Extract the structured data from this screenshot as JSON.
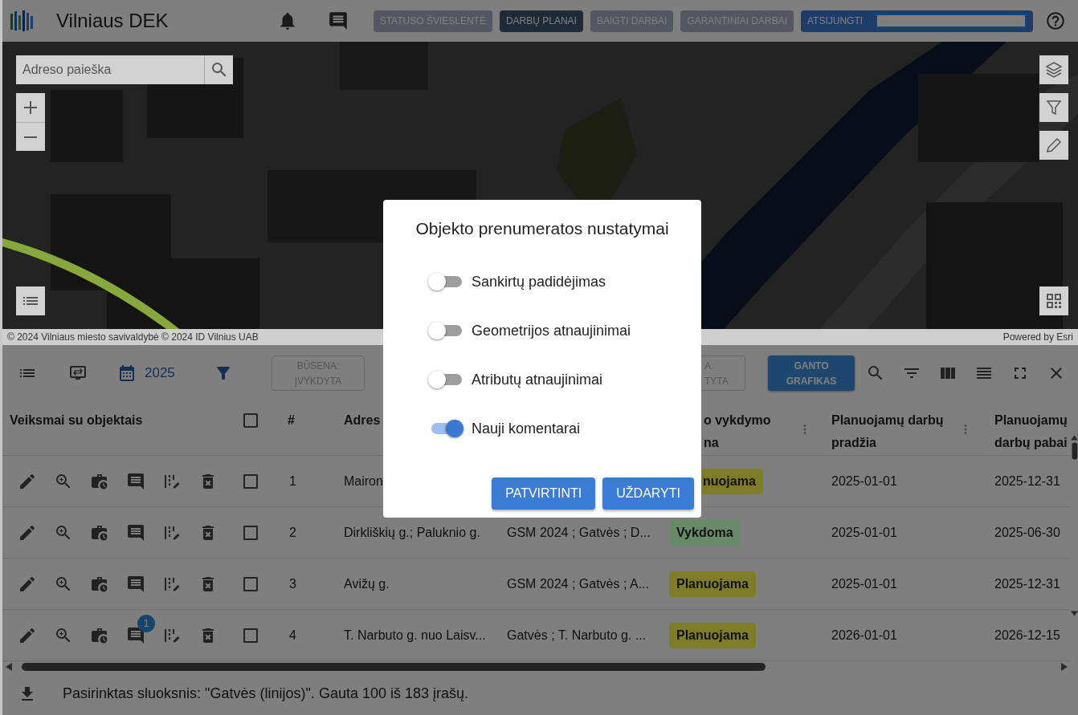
{
  "app": {
    "title": "Vilniaus DEK"
  },
  "nav": [
    {
      "label": "STATUSO ŠVIESLENTĖ",
      "kind": "page",
      "selected": false
    },
    {
      "label": "DARBŲ PLANAI",
      "kind": "page",
      "selected": true
    },
    {
      "label": "BAIGTI DARBAI",
      "kind": "page",
      "selected": false
    },
    {
      "label": "GARANTINIAI DARBAI",
      "kind": "page",
      "selected": false
    },
    {
      "label": "ATSIJUNGTI",
      "kind": "logout"
    }
  ],
  "map": {
    "search": {
      "placeholder": "Adreso paieška"
    },
    "attribution": "© 2024 Vilniaus miesto savivaldybė © 2024 ID Vilnius UAB",
    "powered_by": "Powered by Esri"
  },
  "toolbar": {
    "year": "2025",
    "filters": [
      {
        "lines": [
          "BŪSENA:",
          "ĮVYKDYTA"
        ],
        "cut": false
      },
      {
        "lines": [
          "A:",
          "TYTA"
        ],
        "cut": true
      }
    ],
    "gantt": [
      "GANTO",
      "GRAFIKAS"
    ]
  },
  "table": {
    "columns": [
      {
        "label": "Veiksmai su objektais"
      },
      {
        "kind": "checkbox",
        "checked": false
      },
      {
        "label": "#"
      },
      {
        "label": "Adres"
      },
      {
        "lines": [
          "o vykdymo",
          "na"
        ],
        "menu": true
      },
      {
        "label": "Planuojamų darbų pradžia",
        "menu": true
      },
      {
        "label": "Planuojamų darbų pabai"
      }
    ],
    "rows": [
      {
        "checked": false,
        "number": "1",
        "address": "Mairon",
        "status": {
          "label": "nuojama",
          "color": "#7d7d28",
          "cut": true
        },
        "start": "2025-01-01",
        "end": "2025-12-31"
      },
      {
        "checked": false,
        "number": "2",
        "address": "Dirkliškių g.; Paluknio g.",
        "column_5": "GSM 2024 ; Gatvės ; D...",
        "status": {
          "label": "Vykdoma",
          "color": "#698a68",
          "cut": false
        },
        "start": "2025-01-01",
        "end": "2025-06-30"
      },
      {
        "checked": false,
        "number": "3",
        "address": "Avižų g.",
        "column_5": "GSM 2024 ; Gatvės ; A...",
        "status": {
          "label": "Planuojama",
          "color": "#7d7d28",
          "cut": false
        },
        "start": "2025-01-01",
        "end": "2025-12-31"
      },
      {
        "checked": false,
        "number": "4",
        "address": "T. Narbuto g. nuo Laisv...",
        "column_5": "Gatvės ; T. Narbuto g. ...",
        "comment_count": "1",
        "status": {
          "label": "Planuojama",
          "color": "#7d7d28",
          "cut": false
        },
        "start": "2026-01-01",
        "end": "2026-12-15"
      }
    ]
  },
  "footer": {
    "text": "Pasirinktas sluoksnis: \"Gatvės (linijos)\". Gauta 100 iš 183 įrašų."
  },
  "modal": {
    "title": "Objekto prenumeratos nustatymai",
    "toggles": [
      {
        "label": "Sankirtų padidėjimas",
        "on": false
      },
      {
        "label": "Geometrijos atnaujinimai",
        "on": false
      },
      {
        "label": "Atributų atnaujinimai",
        "on": false
      },
      {
        "label": "Nauji komentarai",
        "on": true
      }
    ],
    "buttons": [
      "PATVIRTINTI",
      "UŽDARYTI"
    ]
  }
}
